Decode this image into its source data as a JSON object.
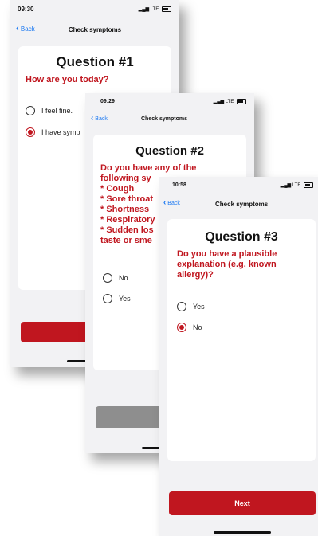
{
  "colors": {
    "accent": "#c0161f",
    "link": "#1877f2",
    "disabled": "#8e8e8e"
  },
  "screen1": {
    "time": "09:30",
    "signal": "LTE",
    "back_label": "Back",
    "nav_title": "Check symptoms",
    "question_title": "Question #1",
    "question_text": "How are you today?",
    "options": [
      {
        "label": "I feel fine.",
        "selected": false
      },
      {
        "label": "I have symp",
        "selected": true
      }
    ]
  },
  "screen2": {
    "time": "09:29",
    "signal": "LTE",
    "back_label": "Back",
    "nav_title": "Check symptoms",
    "question_title": "Question #2",
    "question_lines": [
      "Do you have any of the",
      "following sy",
      "* Cough",
      "* Sore throat",
      "* Shortness",
      "* Respiratory",
      "* Sudden los",
      "taste or sme"
    ],
    "options": [
      {
        "label": "No",
        "selected": false
      },
      {
        "label": "Yes",
        "selected": false
      }
    ]
  },
  "screen3": {
    "time": "10:58",
    "signal": "LTE",
    "back_label": "Back",
    "nav_title": "Check symptoms",
    "question_title": "Question #3",
    "question_text": "Do you have a plausible explanation (e.g. known allergy)?",
    "options": [
      {
        "label": "Yes",
        "selected": false
      },
      {
        "label": "No",
        "selected": true
      }
    ],
    "next_label": "Next"
  }
}
